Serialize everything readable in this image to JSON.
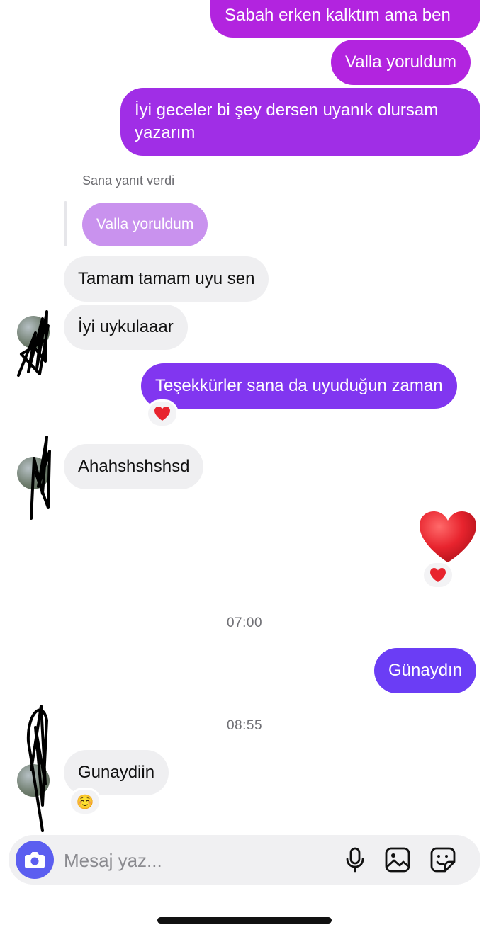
{
  "messages": {
    "m1": "Sabah erken kalktım ama ben",
    "m2": "Valla yoruldum",
    "m3": "İyi geceler bi şey dersen uyanık olursam yazarım",
    "reply_label": "Sana yanıt verdi",
    "reply_quote": "Valla yoruldum",
    "m4": "Tamam tamam uyu sen",
    "m5": "İyi uykulaaar",
    "m6": "Teşekkürler sana da uyuduğun zaman",
    "m7": "Ahahshshshsd",
    "m8": "❤️",
    "time1": "07:00",
    "m9": "Günaydın",
    "time2": "08:55",
    "m10": "Gunaydiin"
  },
  "reactions": {
    "r1": "heart",
    "r2": "heart",
    "r3": "☺️"
  },
  "composer": {
    "placeholder": "Mesaj yaz...",
    "icons": [
      "camera-icon",
      "microphone-icon",
      "gallery-icon",
      "sticker-icon"
    ]
  },
  "colors": {
    "outgoing_top": "#b224df",
    "outgoing_bottom": "#6b3df5",
    "incoming": "#efeff1",
    "camera_button": "#5b5ef0",
    "heart": "#e8242e"
  }
}
